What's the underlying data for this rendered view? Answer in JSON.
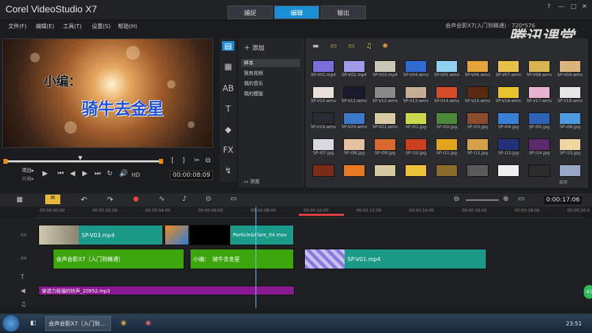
{
  "app": {
    "title": "Corel VideoStudio X7",
    "tabs": [
      "捕捉",
      "编辑",
      "输出"
    ],
    "active_tab": "编辑",
    "watermark": "腾讯课堂",
    "watermark_small": "会声会影X7(入门到精通) · 720*576",
    "window_controls": [
      "?",
      "—",
      "□",
      "✕"
    ]
  },
  "menu": [
    "文件(F)",
    "编辑(E)",
    "工具(T)",
    "设置(S)",
    "帮助(H)"
  ],
  "preview": {
    "overlay_line1": "小编：",
    "overlay_line2": "骑牛去金星",
    "mode_project": "项目▸",
    "mode_clip": "片段▸",
    "timecode": "00:00:08:09",
    "hd": "HD"
  },
  "library": {
    "add_label": "添加",
    "tree": [
      "样本",
      "我有视频",
      "我的音乐",
      "我的模版"
    ],
    "browse": "浏览",
    "thumbnails": [
      {
        "label": "SP-V01.mp4",
        "color": "#7a6fd9"
      },
      {
        "label": "SP-V02.mp4",
        "color": "#9f9be8"
      },
      {
        "label": "SP-V03.mp4",
        "color": "#c9c7b8"
      },
      {
        "label": "SP-V04.wmv",
        "color": "#2f6bd0"
      },
      {
        "label": "SP-V05.wmv",
        "color": "#8fd1ee"
      },
      {
        "label": "SP-V06.wmv",
        "color": "#e4a23a"
      },
      {
        "label": "SP-V07.wmv",
        "color": "#e6c04a"
      },
      {
        "label": "SP-V08.wmv",
        "color": "#d9b552"
      },
      {
        "label": "SP-V09.wmv",
        "color": "#dcb37a"
      },
      {
        "label": "SP-V10.wmv",
        "color": "#e7e0d8"
      },
      {
        "label": "SP-V11.wmv",
        "color": "#1a1a2e"
      },
      {
        "label": "SP-V12.wmv",
        "color": "#8a8a8a"
      },
      {
        "label": "SP-V13.wmv",
        "color": "#c4ad94"
      },
      {
        "label": "SP-V14.wmv",
        "color": "#d64c2a"
      },
      {
        "label": "SP-V15.wmv",
        "color": "#5c2a12"
      },
      {
        "label": "SP-V16.wmv",
        "color": "#e7c22c"
      },
      {
        "label": "SP-V17.wmv",
        "color": "#e8b3d0"
      },
      {
        "label": "SP-V18.wmv",
        "color": "#e6e6e6"
      },
      {
        "label": "SP-V19.wmv",
        "color": "#2a2a33"
      },
      {
        "label": "SP-V20.wmv",
        "color": "#3c78c8"
      },
      {
        "label": "SP-V21.wmv",
        "color": "#d7c9a3"
      },
      {
        "label": "SP-I01.jpg",
        "color": "#c9d94a"
      },
      {
        "label": "SP-I02.jpg",
        "color": "#4b8a3a"
      },
      {
        "label": "SP-I03.jpg",
        "color": "#8a4c2c"
      },
      {
        "label": "SP-I04.jpg",
        "color": "#3a7fd6"
      },
      {
        "label": "SP-I05.jpg",
        "color": "#2d63b5"
      },
      {
        "label": "SP-I06.jpg",
        "color": "#4d9ae0"
      },
      {
        "label": "SP-I07.jpg",
        "color": "#d9d9e6"
      },
      {
        "label": "SP-I08.jpg",
        "color": "#e2c0a0"
      },
      {
        "label": "SP-I09.jpg",
        "color": "#d86a30"
      },
      {
        "label": "SP-I10.jpg",
        "color": "#c8401c"
      },
      {
        "label": "SP-I11.jpg",
        "color": "#e0a51a"
      },
      {
        "label": "SP-I12.jpg",
        "color": "#d4a04a"
      },
      {
        "label": "SP-I13.jpg",
        "color": "#23307a"
      },
      {
        "label": "SP-I14.jpg",
        "color": "#5a2a6a"
      },
      {
        "label": "SP-I15.jpg",
        "color": "#efd6a0"
      },
      {
        "label": "",
        "color": "#7a2c18"
      },
      {
        "label": "",
        "color": "#e87a24"
      },
      {
        "label": "",
        "color": "#d4c9a0"
      },
      {
        "label": "",
        "color": "#f0c23a"
      },
      {
        "label": "",
        "color": "#8a6a2a"
      },
      {
        "label": "",
        "color": "#5a5a5a"
      },
      {
        "label": "",
        "color": "#efefef"
      },
      {
        "label": "",
        "color": "#2c2c2c"
      },
      {
        "label": "",
        "color": "#9aa8c8"
      }
    ],
    "options_label": "选项"
  },
  "timeline": {
    "timecode": "0:00:17:06",
    "ruler": [
      "00:00:00:00",
      "00:00:02:00",
      "00:00:04:00",
      "00:00:06:00",
      "00:00:08:00",
      "00:00:10:00",
      "00:00:12:00",
      "00:00:14:00",
      "00:00:16:00",
      "00:00:18:00",
      "00:00:20:0"
    ],
    "clips": {
      "v1": "SP-V03.mp4",
      "v2": "Particle&Flare_04.mov",
      "t1": "会声会影X7（入门到精通）",
      "t2": "小编：　骑牛去金星",
      "v3": "SP-V01.mp4",
      "audio": "穿透力极强的铃声_20952.mp3"
    }
  },
  "taskbar": {
    "app": "会声会影X7（入门到...",
    "clock": "23:51",
    "chat_badge": "41"
  }
}
